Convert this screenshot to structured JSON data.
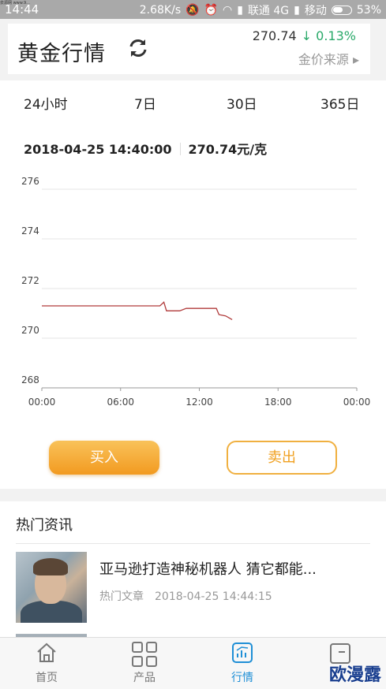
{
  "statusbar": {
    "time": "14:44",
    "watermark": "泉源网 www.9...",
    "speed": "2.68K/s",
    "carrier1": "联通 4G",
    "carrier2": "移动",
    "battery": "53%"
  },
  "header": {
    "title": "黄金行情",
    "price": "270.74",
    "change": "↓ 0.13%",
    "source_label": "金价来源 ▸"
  },
  "tabs": [
    "24小时",
    "7日",
    "30日",
    "365日"
  ],
  "info": {
    "datetime": "2018-04-25 14:40:00",
    "price": "270.74元/克"
  },
  "chart_data": {
    "type": "line",
    "ylim": [
      268,
      276
    ],
    "yticks": [
      "276",
      "274",
      "272",
      "270",
      "268"
    ],
    "xticks": [
      "00:00",
      "06:00",
      "12:00",
      "18:00",
      "00:00"
    ],
    "x_hours": [
      0,
      5,
      9.0,
      9.3,
      9.5,
      10.5,
      11.0,
      12.0,
      13.3,
      13.5,
      14.0,
      14.5
    ],
    "values": [
      271.3,
      271.3,
      271.3,
      271.45,
      271.1,
      271.1,
      271.2,
      271.2,
      271.2,
      270.95,
      270.9,
      270.75
    ],
    "line_color": "#b03a3a",
    "grid": true
  },
  "actions": {
    "buy_label": "买入",
    "sell_label": "卖出"
  },
  "news": {
    "section_title": "热门资讯",
    "article": {
      "title": "亚马逊打造神秘机器人 猜它都能...",
      "category": "热门文章",
      "time": "2018-04-25 14:44:15"
    }
  },
  "bottom_nav": [
    {
      "label": "首页",
      "icon": "home-icon"
    },
    {
      "label": "产品",
      "icon": "grid-icon"
    },
    {
      "label": "行情",
      "icon": "chart-icon"
    },
    {
      "label": "",
      "icon": "wallet-icon"
    }
  ],
  "overlay_watermark": "欧漫露"
}
